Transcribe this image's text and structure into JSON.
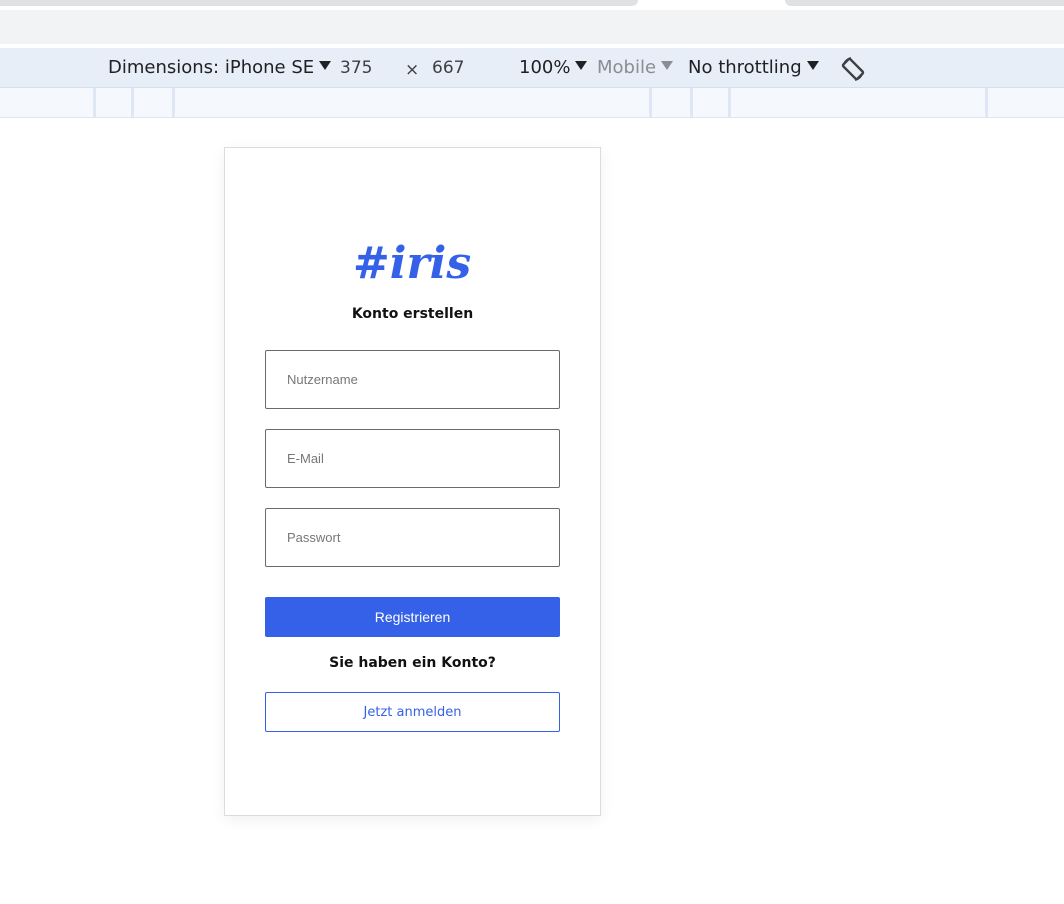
{
  "toolbar": {
    "dimensions_label": "Dimensions: iPhone SE",
    "width": "375",
    "times": "×",
    "height": "667",
    "zoom": "100%",
    "device_type": "Mobile",
    "throttling": "No throttling",
    "rotate_icon": "rotate-icon"
  },
  "app": {
    "brand": "#iris",
    "brand_color": "#3461e8",
    "heading": "Konto erstellen",
    "fields": [
      {
        "name": "username",
        "placeholder": "Nutzername",
        "value": ""
      },
      {
        "name": "email",
        "placeholder": "E-Mail",
        "value": ""
      },
      {
        "name": "password",
        "placeholder": "Passwort",
        "value": ""
      }
    ],
    "register_label": "Registrieren",
    "have_account": "Sie haben ein Konto?",
    "login_label": "Jetzt anmelden"
  }
}
